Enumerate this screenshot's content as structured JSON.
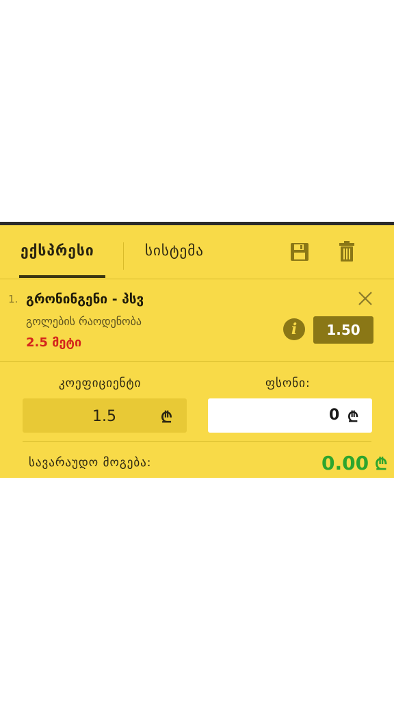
{
  "tabs": {
    "express": "ექსპრესი",
    "system": "სისტემა"
  },
  "bet": {
    "number": "1.",
    "title": "გრონინგენი - პსვ",
    "market": "გოლების რაოდენობა",
    "outcome": "2.5 მეტი",
    "odds": "1.50"
  },
  "labels": {
    "coefficient": "კოეფიციენტი",
    "stake": "ფსონი:",
    "potential_win": "სავარაუდო მოგება:"
  },
  "values": {
    "coefficient": "1.5",
    "stake": "0",
    "potential_win": "0.00",
    "currency": "₾"
  },
  "icons": {
    "save": "floppy-disk",
    "delete": "trash-can",
    "remove": "close",
    "info": "info"
  },
  "colors": {
    "panel": "#f8da48",
    "accent_dark": "#8a7716",
    "win": "#2ea52e",
    "outcome": "#d4241c"
  }
}
